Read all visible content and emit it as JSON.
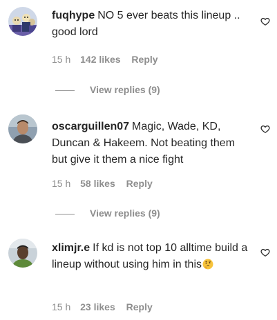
{
  "comments": [
    {
      "username": "fuqhype",
      "text": "NO 5 ever beats this lineup .. good lord",
      "time": "15 h",
      "likes": "142 likes",
      "reply": "Reply",
      "view_replies": "View replies (9)",
      "avatar_icon": "avatar-cartoon-icon"
    },
    {
      "username": "oscarguillen07",
      "text": "Magic, Wade, KD, Duncan & Hakeem. Not beating them but give it them a nice fight",
      "time": "15 h",
      "likes": "58 likes",
      "reply": "Reply",
      "view_replies": "View replies (9)",
      "avatar_icon": "avatar-photo-icon"
    },
    {
      "username": "xlimjr.e",
      "text": "If kd is not top 10 alltime build a lineup without using him in this",
      "emoji": "thinking-face-emoji",
      "time": "15 h",
      "likes": "23 likes",
      "reply": "Reply",
      "avatar_icon": "avatar-photo-icon"
    }
  ],
  "icons": {
    "like": "heart-outline-icon"
  },
  "colors": {
    "text": "#262626",
    "secondary": "#8e8e8e",
    "background": "#ffffff"
  }
}
